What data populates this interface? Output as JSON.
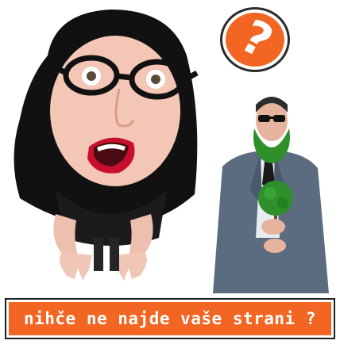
{
  "banner": {
    "text": "nihče ne najde vaše strani ?"
  },
  "help_badge": {
    "glyph": "?",
    "icon": "question-mark-icon"
  },
  "colors": {
    "accent": "#f26522",
    "outline": "#1e1e1e",
    "suit": "#5b6c80",
    "beard": "#2f8f2a",
    "hair": "#111111",
    "skin": "#f3c6b5"
  }
}
